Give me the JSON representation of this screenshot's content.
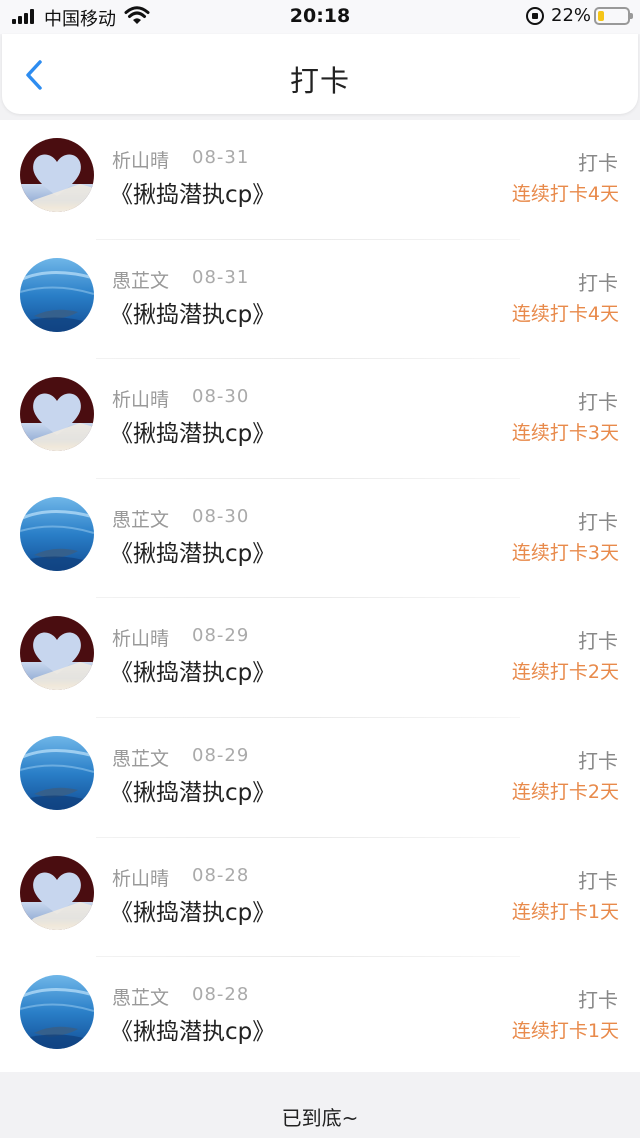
{
  "status_bar": {
    "carrier": "中国移动",
    "time": "20:18",
    "battery_percent": "22%",
    "battery_level": 0.22
  },
  "header": {
    "title": "打卡",
    "back_icon": "chevron-left-icon",
    "accent_color": "#2d8cf0"
  },
  "list": {
    "items": [
      {
        "user": "析山晴",
        "date": "08-31",
        "title": "《揪捣潜执cp》",
        "action": "打卡",
        "streak": "连续打卡4天",
        "avatar": "heart"
      },
      {
        "user": "愚芷文",
        "date": "08-31",
        "title": "《揪捣潜执cp》",
        "action": "打卡",
        "streak": "连续打卡4天",
        "avatar": "ocean"
      },
      {
        "user": "析山晴",
        "date": "08-30",
        "title": "《揪捣潜执cp》",
        "action": "打卡",
        "streak": "连续打卡3天",
        "avatar": "heart"
      },
      {
        "user": "愚芷文",
        "date": "08-30",
        "title": "《揪捣潜执cp》",
        "action": "打卡",
        "streak": "连续打卡3天",
        "avatar": "ocean"
      },
      {
        "user": "析山晴",
        "date": "08-29",
        "title": "《揪捣潜执cp》",
        "action": "打卡",
        "streak": "连续打卡2天",
        "avatar": "heart"
      },
      {
        "user": "愚芷文",
        "date": "08-29",
        "title": "《揪捣潜执cp》",
        "action": "打卡",
        "streak": "连续打卡2天",
        "avatar": "ocean"
      },
      {
        "user": "析山晴",
        "date": "08-28",
        "title": "《揪捣潜执cp》",
        "action": "打卡",
        "streak": "连续打卡1天",
        "avatar": "heart"
      },
      {
        "user": "愚芷文",
        "date": "08-28",
        "title": "《揪捣潜执cp》",
        "action": "打卡",
        "streak": "连续打卡1天",
        "avatar": "ocean"
      }
    ]
  },
  "footer": {
    "end_text": "已到底~"
  },
  "colors": {
    "streak": "#e88a4b",
    "background": "#f2f2f4"
  }
}
